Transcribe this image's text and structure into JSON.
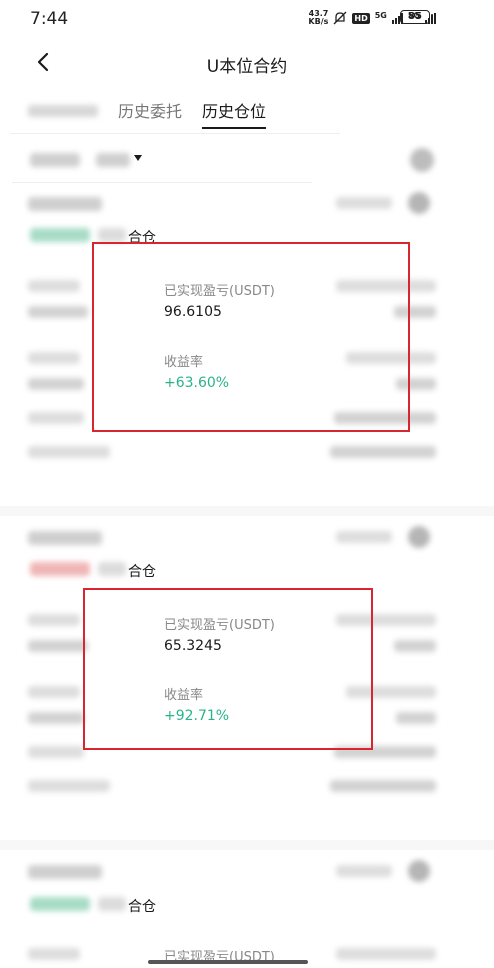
{
  "status_bar": {
    "time": "7:44",
    "speed_value": "43.7",
    "speed_unit": "KB/s",
    "hd": "HD",
    "net1": "5G",
    "net2": "5G",
    "battery": "85"
  },
  "nav": {
    "title": "U本位合约"
  },
  "tabs": {
    "orders": "历史委托",
    "positions": "历史仓位"
  },
  "cards": [
    {
      "close_label": "合仓",
      "pnl_label": "已实现盈亏(USDT)",
      "pnl_value": "96.6105",
      "roi_label": "收益率",
      "roi_value": "+63.60%"
    },
    {
      "close_label": "合仓",
      "pnl_label": "已实现盈亏(USDT)",
      "pnl_value": "65.3245",
      "roi_label": "收益率",
      "roi_value": "+92.71%"
    },
    {
      "close_label": "合仓",
      "pnl_label": "已实现盈亏(USDT)"
    }
  ],
  "colors": {
    "accent_green": "#2ab38a",
    "accent_red": "#d7262d",
    "highlight_box": "#d7262d"
  }
}
